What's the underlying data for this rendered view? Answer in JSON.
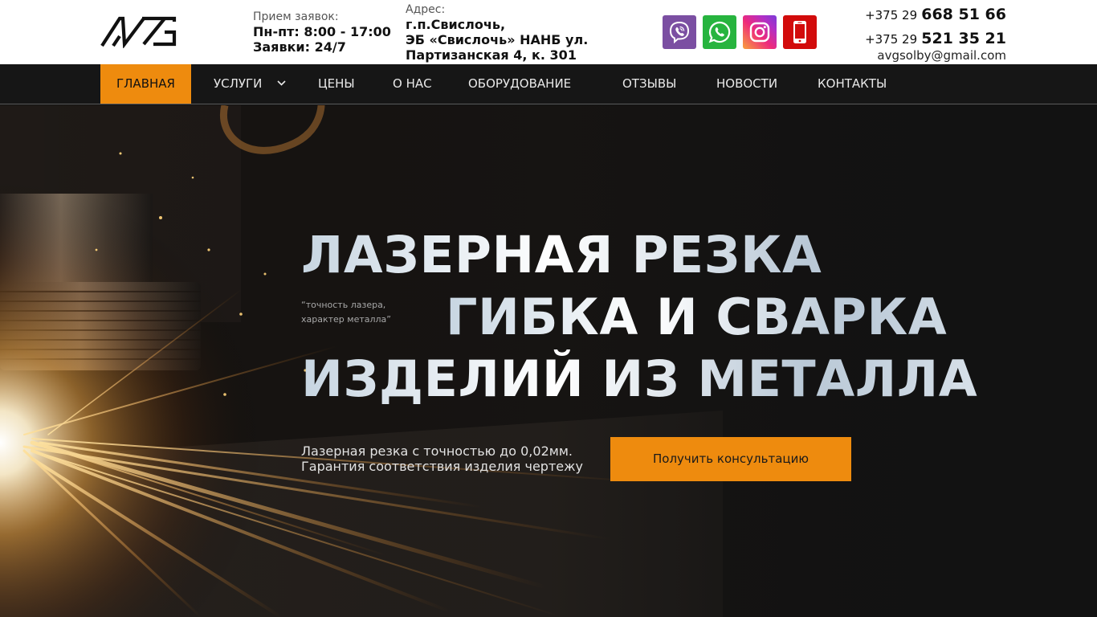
{
  "header": {
    "hours_label": "Прием заявок:",
    "hours_line1": "Пн-пт: 8:00 - 17:00",
    "hours_line2": "Заявки: 24/7",
    "address_label": "Адрес:",
    "address_line1": "г.п.Свислочь,",
    "address_line2": "ЭБ «Свислочь» НАНБ ул.",
    "address_line3": "Партизанская 4, к. 301",
    "social": [
      {
        "name": "viber",
        "icon": "viber-icon",
        "color": "#7b4fa2"
      },
      {
        "name": "whatsapp",
        "icon": "whatsapp-icon",
        "color": "#27b43f"
      },
      {
        "name": "instagram",
        "icon": "instagram-icon",
        "color": "#d6249f"
      },
      {
        "name": "phone",
        "icon": "phone-icon",
        "color": "#d20b0b"
      }
    ],
    "phones": [
      {
        "code": "+375 29",
        "number": "668 51 66"
      },
      {
        "code": "+375 29",
        "number": "521 35 21"
      }
    ],
    "email": "avgsolby@gmail.com"
  },
  "nav": {
    "items": [
      {
        "label": "ГЛАВНАЯ",
        "active": true
      },
      {
        "label": "УСЛУГИ",
        "has_dropdown": true
      },
      {
        "label": "ЦЕНЫ"
      },
      {
        "label": "О НАС"
      },
      {
        "label": "ОБОРУДОВАНИЕ"
      },
      {
        "label": "ОТЗЫВЫ"
      },
      {
        "label": "НОВОСТИ"
      },
      {
        "label": "КОНТАКТЫ"
      }
    ]
  },
  "hero": {
    "title_line1": "ЛАЗЕРНАЯ РЕЗКА",
    "title_line2": "ГИБКА И СВАРКА",
    "title_line3": "ИЗДЕЛИЙ ИЗ МЕТАЛЛА",
    "tagline": "“точность лазера,\nхарактер металла”",
    "subtitle_line1": "Лазерная резка с точностью до 0,02мм.",
    "subtitle_line2": "Гарантия соответствия изделия чертежу",
    "cta_label": "Получить консультацию"
  },
  "colors": {
    "accent": "#ee8b0e",
    "nav_bg": "#161616",
    "header_bg": "#ffffff"
  }
}
